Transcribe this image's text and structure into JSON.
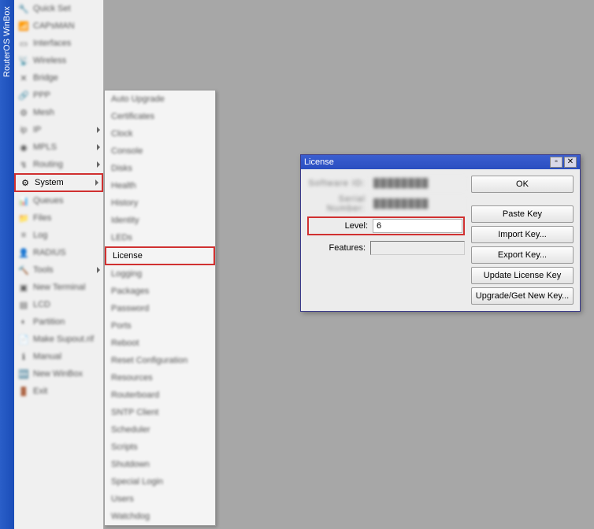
{
  "app_title": "RouterOS WinBox",
  "sidebar": [
    {
      "icon": "🔧",
      "label": "Quick Set",
      "blur": true
    },
    {
      "icon": "📶",
      "label": "CAPsMAN",
      "blur": true
    },
    {
      "icon": "▭",
      "label": "Interfaces",
      "blur": true
    },
    {
      "icon": "📡",
      "label": "Wireless",
      "blur": true
    },
    {
      "icon": "✕",
      "label": "Bridge",
      "blur": true
    },
    {
      "icon": "🔗",
      "label": "PPP",
      "blur": true
    },
    {
      "icon": "⚙",
      "label": "Mesh",
      "blur": true
    },
    {
      "icon": "ip",
      "label": "IP",
      "arrow": true,
      "blur": true
    },
    {
      "icon": "◉",
      "label": "MPLS",
      "arrow": true,
      "blur": true
    },
    {
      "icon": "↯",
      "label": "Routing",
      "arrow": true,
      "blur": true
    },
    {
      "icon": "⚙",
      "label": "System",
      "arrow": true,
      "highlighted": true
    },
    {
      "icon": "📊",
      "label": "Queues",
      "blur": true
    },
    {
      "icon": "📁",
      "label": "Files",
      "blur": true
    },
    {
      "icon": "≡",
      "label": "Log",
      "blur": true
    },
    {
      "icon": "👤",
      "label": "RADIUS",
      "blur": true
    },
    {
      "icon": "🔨",
      "label": "Tools",
      "arrow": true,
      "blur": true
    },
    {
      "icon": "▣",
      "label": "New Terminal",
      "blur": true
    },
    {
      "icon": "▤",
      "label": "LCD",
      "blur": true
    },
    {
      "icon": "◐",
      "label": "Partition",
      "blur": true
    },
    {
      "icon": "📄",
      "label": "Make Supout.rif",
      "blur": true
    },
    {
      "icon": "ℹ",
      "label": "Manual",
      "blur": true
    },
    {
      "icon": "🆕",
      "label": "New WinBox",
      "blur": true
    },
    {
      "icon": "🚪",
      "label": "Exit",
      "blur": true
    }
  ],
  "submenu": [
    {
      "label": "Auto Upgrade",
      "blur": true
    },
    {
      "label": "Certificates",
      "blur": true
    },
    {
      "label": "Clock",
      "blur": true
    },
    {
      "label": "Console",
      "blur": true
    },
    {
      "label": "Disks",
      "blur": true
    },
    {
      "label": "Health",
      "blur": true
    },
    {
      "label": "History",
      "blur": true
    },
    {
      "label": "Identity",
      "blur": true
    },
    {
      "label": "LEDs",
      "blur": true
    },
    {
      "label": "License",
      "highlighted": true
    },
    {
      "label": "Logging",
      "blur": true
    },
    {
      "label": "Packages",
      "blur": true
    },
    {
      "label": "Password",
      "blur": true
    },
    {
      "label": "Ports",
      "blur": true
    },
    {
      "label": "Reboot",
      "blur": true
    },
    {
      "label": "Reset Configuration",
      "blur": true
    },
    {
      "label": "Resources",
      "blur": true
    },
    {
      "label": "Routerboard",
      "blur": true
    },
    {
      "label": "SNTP Client",
      "blur": true
    },
    {
      "label": "Scheduler",
      "blur": true
    },
    {
      "label": "Scripts",
      "blur": true
    },
    {
      "label": "Shutdown",
      "blur": true
    },
    {
      "label": "Special Login",
      "blur": true
    },
    {
      "label": "Users",
      "blur": true
    },
    {
      "label": "Watchdog",
      "blur": true
    }
  ],
  "dialog": {
    "title": "License",
    "fields": {
      "software_id": {
        "label": "Software ID:",
        "value": "████████",
        "blur_label": true,
        "blur_value": true
      },
      "serial_number": {
        "label": "Serial Number:",
        "value": "████████",
        "blur_label": true,
        "blur_value": true
      },
      "level": {
        "label": "Level:",
        "value": "6",
        "highlighted": true
      },
      "features": {
        "label": "Features:",
        "value": ""
      }
    },
    "buttons": {
      "ok": "OK",
      "paste_key": "Paste Key",
      "import_key": "Import Key...",
      "export_key": "Export Key...",
      "update_license": "Update License Key",
      "upgrade_get": "Upgrade/Get New Key..."
    }
  }
}
